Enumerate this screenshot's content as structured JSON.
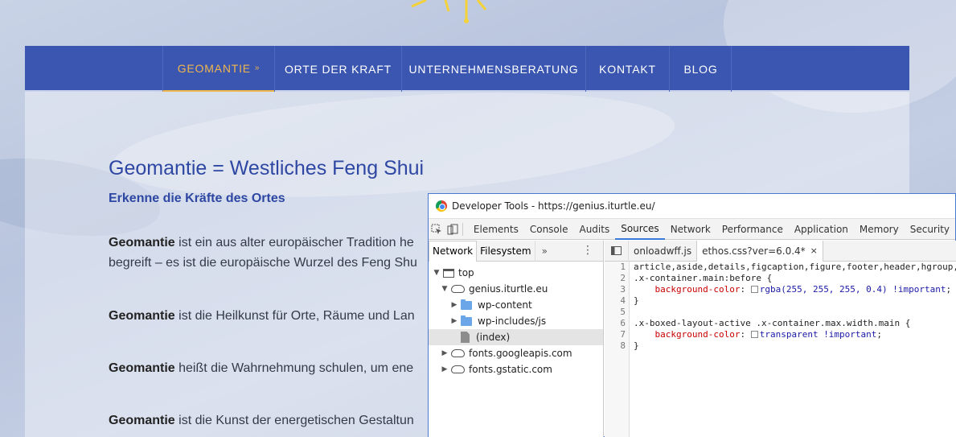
{
  "nav": {
    "items": [
      {
        "label": "GEOMANTIE",
        "active": true
      },
      {
        "label": "ORTE DER KRAFT",
        "active": false
      },
      {
        "label": "UNTERNEHMENSBERATUNG",
        "active": false
      },
      {
        "label": "KONTAKT",
        "active": false
      },
      {
        "label": "BLOG",
        "active": false
      }
    ],
    "chevron_glyph": "»"
  },
  "page": {
    "title": "Geomantie = Westliches Feng Shui",
    "subtitle": "Erkenne die Kräfte des Ortes",
    "paragraphs": [
      {
        "bold": "Geomantie",
        "line1": " ist ein aus alter europäischer Tradition he",
        "line2": "begreift – es ist die europäische Wurzel des Feng Shu"
      },
      {
        "bold": "Geomantie",
        "line1": " ist die Heilkunst für Orte, Räume und Lan",
        "line2": ""
      },
      {
        "bold": "Geomantie",
        "line1": " heißt die Wahrnehmung schulen, um ene",
        "line2": ""
      },
      {
        "bold": "Geomantie",
        "line1": " ist die Kunst der energetischen Gestaltun",
        "line2": ""
      }
    ]
  },
  "devtools": {
    "title": "Developer Tools - https://genius.iturtle.eu/",
    "tabs": [
      "Elements",
      "Console",
      "Audits",
      "Sources",
      "Network",
      "Performance",
      "Application",
      "Memory",
      "Security"
    ],
    "active_tab": "Sources",
    "navigator": {
      "tabs": [
        "Network",
        "Filesystem"
      ],
      "more": "»",
      "menu": "⋮",
      "tree": [
        {
          "label": "top",
          "icon": "frame-icon",
          "arrow": "▼",
          "depth": 0
        },
        {
          "label": "genius.iturtle.eu",
          "icon": "cloud-icon",
          "arrow": "▼",
          "depth": 1
        },
        {
          "label": "wp-content",
          "icon": "folder-icon",
          "arrow": "▶",
          "depth": 2
        },
        {
          "label": "wp-includes/js",
          "icon": "folder-icon",
          "arrow": "▶",
          "depth": 2
        },
        {
          "label": "(index)",
          "icon": "file-icon",
          "arrow": "",
          "depth": 2,
          "selected": true
        },
        {
          "label": "fonts.googleapis.com",
          "icon": "cloud-icon",
          "arrow": "▶",
          "depth": 1
        },
        {
          "label": "fonts.gstatic.com",
          "icon": "cloud-icon",
          "arrow": "▶",
          "depth": 1
        }
      ]
    },
    "editor": {
      "tabs": [
        {
          "label": "onloadwff.js",
          "active": false
        },
        {
          "label": "ethos.css?ver=6.0.4*",
          "active": true
        }
      ],
      "close_glyph": "×",
      "lines": [
        {
          "n": "1",
          "text": "article,aside,details,figcaption,figure,footer,header,hgroup,"
        },
        {
          "n": "2",
          "text": ".x-container.main:before {"
        },
        {
          "n": "3",
          "prop": "background-color",
          "val": "rgba(255, 255, 255, 0.4) !important"
        },
        {
          "n": "4",
          "text": "}"
        },
        {
          "n": "5",
          "text": ""
        },
        {
          "n": "6",
          "text": ".x-boxed-layout-active .x-container.max.width.main {"
        },
        {
          "n": "7",
          "prop": "background-color",
          "val": "transparent !important"
        },
        {
          "n": "8",
          "text": "}"
        }
      ]
    }
  },
  "colors": {
    "nav_bg": "#3a56b0",
    "nav_active": "#f0b64e",
    "heading": "#2e47a3",
    "devtools_accent": "#3879d9"
  }
}
